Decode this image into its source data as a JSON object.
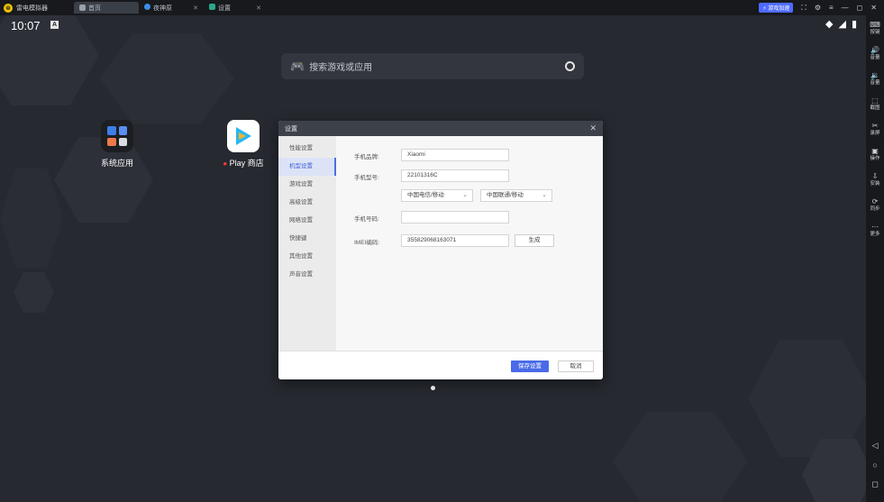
{
  "titlebar": {
    "app_name": "雷电模拟器",
    "tabs": [
      {
        "label": "首页",
        "icon": "home-icon"
      },
      {
        "label": "夜神原",
        "icon": "app-icon",
        "close": "✕"
      },
      {
        "label": "设置",
        "icon": "settings-tab-icon",
        "close": "✕"
      }
    ],
    "speed_label": "⚡ 游戏加速",
    "controls": [
      "⛶",
      "⚙",
      "≡",
      "—",
      "◻",
      "✕"
    ]
  },
  "status": {
    "time": "10:07",
    "notif": "A"
  },
  "search": {
    "placeholder": "搜索游戏或应用"
  },
  "apps": [
    {
      "label": "系统应用"
    },
    {
      "label": "Play 商店",
      "dot": "●"
    }
  ],
  "dialog": {
    "title": "设置",
    "close": "✕",
    "sidebar": [
      "性能设置",
      "机型设置",
      "游戏设置",
      "高级设置",
      "网络设置",
      "快捷键",
      "其他设置",
      "声音设置"
    ],
    "active_index": 1,
    "fields": {
      "brand_label": "手机品牌:",
      "brand_value": "Xiaomi",
      "model_label": "手机型号:",
      "model_value": "22101316C",
      "operator_select": "中国电信/移动",
      "network_select": "中国联通/移动",
      "phone_label": "手机号码:",
      "phone_value": "",
      "imei_label": "IMEI编码:",
      "imei_value": "355829068163071",
      "imei_button": "生成"
    },
    "save_button": "保存设置",
    "cancel_button": "取消"
  },
  "toolbar": [
    {
      "icon": "keyboard-icon",
      "glyph": "⌨",
      "label": "按键"
    },
    {
      "icon": "volume-up-icon",
      "glyph": "🔊",
      "label": "音量"
    },
    {
      "icon": "volume-down-icon",
      "glyph": "🔉",
      "label": "音量"
    },
    {
      "icon": "screenshot-icon",
      "glyph": "⬚",
      "label": "截图"
    },
    {
      "icon": "scissors-icon",
      "glyph": "✂",
      "label": "录屏"
    },
    {
      "icon": "record-icon",
      "glyph": "▣",
      "label": "操作"
    },
    {
      "icon": "install-icon",
      "glyph": "⇩",
      "label": "安装"
    },
    {
      "icon": "sync-icon",
      "glyph": "⟳",
      "label": "同步"
    },
    {
      "icon": "more-icon",
      "glyph": "⋯",
      "label": "更多"
    }
  ],
  "nav": {
    "back": "◁",
    "home": "○",
    "recent": "◻"
  },
  "colors": {
    "accent": "#4a6ae8",
    "speed": "#4f6bff",
    "background": "#262930"
  }
}
